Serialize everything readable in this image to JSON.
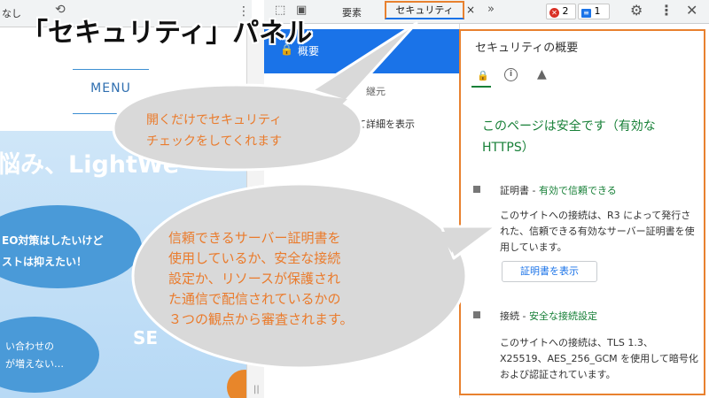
{
  "page_preview": {
    "topbar": {
      "throttle_label": "なし",
      "more_glyph": "⋮"
    },
    "menu_label": "MENU",
    "hero_title": "悩み、LightWe",
    "bubble1": {
      "line1": "EO対策はしたいけど",
      "line2": "ストは抑えたい！"
    },
    "bubble2": {
      "line1": "い合わせの",
      "line2": "が増えない…"
    },
    "hero_side_text": "SE"
  },
  "devtools": {
    "tabs": {
      "elements": "要素",
      "security": "セキュリティ",
      "close_glyph": "×",
      "more_glyph": "»"
    },
    "badges": {
      "errors": "2",
      "messages": "1"
    },
    "sidebar": {
      "overview": "概要",
      "sub_header": "コ　　　　継元",
      "sub_detail": "て詳細を表示"
    },
    "overview": {
      "title": "セキュリティの概要",
      "secure_message": "このページは安全です（有効な HTTPS）",
      "certificate": {
        "label": "証明書 - ",
        "status": "有効で信頼できる",
        "description": "このサイトへの接続は、R3 によって発行された、信頼できる有効なサーバー証明書を使用しています。",
        "button": "証明書を表示"
      },
      "connection": {
        "label": "接続 - ",
        "status": "安全な接続設定",
        "description": "このサイトへの接続は、TLS 1.3、X25519、AES_256_GCM を使用して暗号化および認証されています。"
      }
    }
  },
  "annotations": {
    "title": "「セキュリティ」パネル",
    "callout1": {
      "line1": "開くだけでセキュリティ",
      "line2": "チェックをしてくれます"
    },
    "callout2": {
      "line1": "信頼できるサーバー証明書を",
      "line2": "使用しているか、安全な接続",
      "line3": "設定か、リソースが保護され",
      "line4": "た通信で配信されているかの",
      "line5": "３つの観点から審査されます。"
    }
  },
  "colors": {
    "accent_orange": "#e8812f",
    "secure_green": "#188038",
    "devtools_blue": "#1a73e8",
    "error_red": "#d93025",
    "callout_text": "#ea7b2c"
  },
  "icons": [
    "rotate-icon",
    "inspect-icon",
    "device-toggle-icon",
    "lock-icon",
    "info-icon",
    "warning-icon",
    "gear-icon",
    "kebab-menu-icon",
    "close-icon"
  ]
}
